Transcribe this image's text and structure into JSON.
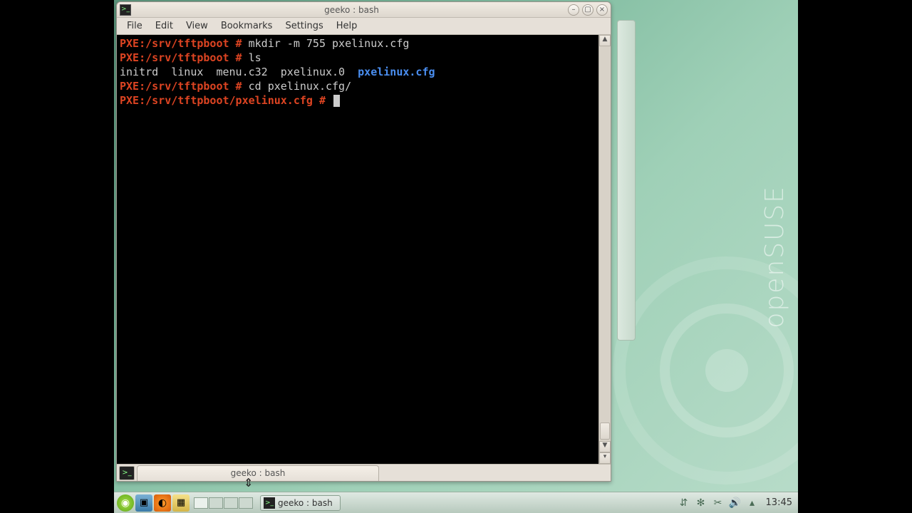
{
  "window": {
    "title": "geeko : bash",
    "icon": "terminal-icon"
  },
  "menu": {
    "file": "File",
    "edit": "Edit",
    "view": "View",
    "bookmarks": "Bookmarks",
    "settings": "Settings",
    "help": "Help"
  },
  "terminal": {
    "lines": [
      {
        "prompt": "PXE:/srv/tftpboot #",
        "cmd": " mkdir -m 755 pxelinux.cfg"
      },
      {
        "prompt": "PXE:/srv/tftpboot #",
        "cmd": " ls"
      },
      {
        "output_plain": "initrd  linux  menu.c32  pxelinux.0  ",
        "output_dir": "pxelinux.cfg"
      },
      {
        "prompt": "PXE:/srv/tftpboot #",
        "cmd": " cd pxelinux.cfg/"
      },
      {
        "prompt": "PXE:/srv/tftpboot/pxelinux.cfg #",
        "cmd": " ",
        "cursor": true
      }
    ]
  },
  "tab": {
    "label": "geeko : bash"
  },
  "taskbar": {
    "task_label": "geeko : bash",
    "clock": "13:45"
  },
  "brand": "openSUSE"
}
